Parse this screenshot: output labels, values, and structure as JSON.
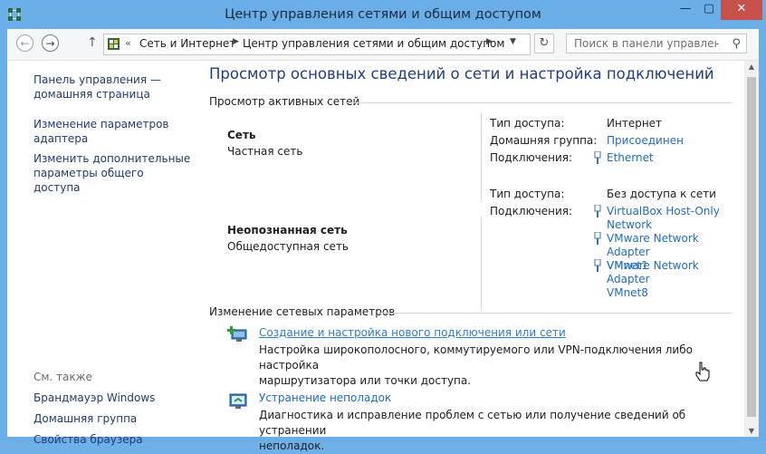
{
  "window": {
    "title": "Центр управления сетями и общим доступом",
    "minimize": "—",
    "maximize": "▢",
    "close": "✕"
  },
  "nav": {
    "back_icon": "←",
    "forward_icon": "→",
    "up_icon": "↑",
    "breadcrumb_sep": "«",
    "breadcrumb": [
      "Сеть и Интернет",
      "Центр управления сетями и общим доступом"
    ],
    "breadcrumb_arrow": "▶",
    "dropdown_icon": "▼",
    "refresh_icon": "↻",
    "search_placeholder": "Поиск в панели управления",
    "search_icon": "⚲"
  },
  "sidebar": {
    "links": [
      [
        "Панель управления —",
        "домашняя страница"
      ],
      [
        "Изменение параметров",
        "адаптера"
      ],
      [
        "Изменить дополнительные",
        "параметры общего доступа"
      ]
    ],
    "see_also_title": "См. также",
    "see_also": [
      "Брандмауэр Windows",
      "Домашняя группа",
      "Свойства браузера"
    ]
  },
  "main": {
    "heading": "Просмотр основных сведений о сети и настройка подключений",
    "active_networks_title": "Просмотр активных сетей",
    "networks": [
      {
        "name": "Сеть",
        "type": "Частная сеть",
        "access_label": "Тип доступа:",
        "access_value": "Интернет",
        "homegroup_label": "Домашняя группа:",
        "homegroup_value": "Присоединен",
        "connections_label": "Подключения:",
        "connections": [
          "Ethernet"
        ]
      },
      {
        "name": "Неопознанная сеть",
        "type": "Общедоступная сеть",
        "access_label": "Тип доступа:",
        "access_value": "Без доступа к сети",
        "connections_label": "Подключения:",
        "connections": [
          [
            "VirtualBox Host-Only",
            "Network"
          ],
          [
            "VMware Network Adapter",
            "VMnet1"
          ],
          [
            "VMware Network Adapter",
            "VMnet8"
          ]
        ]
      }
    ],
    "change_settings_title": "Изменение сетевых параметров",
    "tasks": [
      {
        "link": "Создание и настройка нового подключения или сети",
        "desc": [
          "Настройка широкополосного, коммутируемого или VPN-подключения либо настройка",
          "маршрутизатора или точки доступа."
        ]
      },
      {
        "link": "Устранение неполадок",
        "desc": [
          "Диагностика и исправление проблем с сетью или получение сведений об устранении",
          "неполадок."
        ]
      }
    ]
  },
  "scrollbar": {
    "up_icon": "▲",
    "down_icon": "▼"
  },
  "colors": {
    "frame": "#6aaee8",
    "close_button": "#c7504b",
    "link": "#1e6cc8",
    "heading": "#1e3c8c"
  }
}
